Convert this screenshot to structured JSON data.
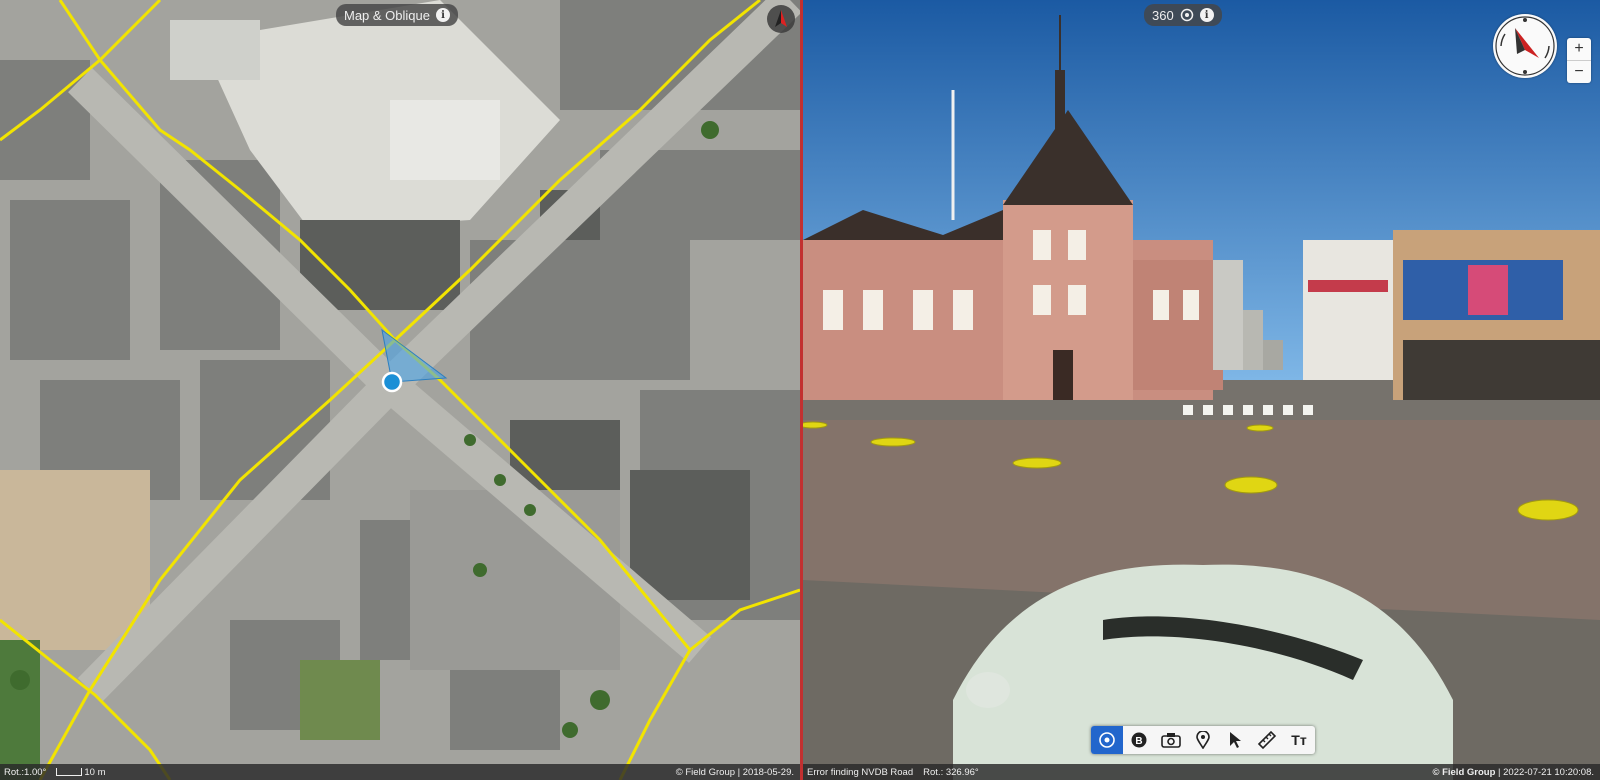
{
  "map": {
    "mode_label": "Map & Oblique",
    "rotation": "Rot.:1.00°",
    "scale_label": "10 m",
    "credit": "© Field Group | 2018-05-29."
  },
  "pano": {
    "mode_label": "360",
    "error_text": "Error finding NVDB Road",
    "rotation": "Rot.: 326.96°",
    "credit_brand": "© Field Group",
    "credit_date": " | 2022-07-21 10:20:08."
  },
  "zoom": {
    "in": "+",
    "out": "−"
  },
  "toolbar": {
    "items": [
      {
        "name": "panorama-tool",
        "icon": "target-icon"
      },
      {
        "name": "tool-b",
        "icon": "b-circle-icon"
      },
      {
        "name": "camera-tool",
        "icon": "camera-icon"
      },
      {
        "name": "pin-tool",
        "icon": "pin-icon"
      },
      {
        "name": "select-tool",
        "icon": "cursor-icon"
      },
      {
        "name": "measure-tool",
        "icon": "ruler-icon"
      },
      {
        "name": "text-tool",
        "icon": "text-icon"
      }
    ],
    "text_label": "Tт"
  },
  "colors": {
    "road_line": "#f2e400",
    "accent": "#2266cc",
    "divider": "#c23030"
  }
}
